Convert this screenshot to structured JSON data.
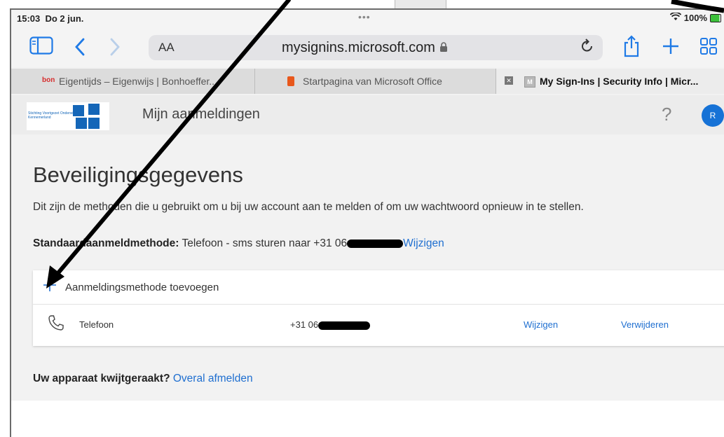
{
  "status": {
    "time": "15:03",
    "date": "Do 2 jun.",
    "multitask_dots": "•••",
    "battery": "100%"
  },
  "toolbar": {
    "text_size": "AA",
    "url": "mysignins.microsoft.com"
  },
  "tabs": [
    {
      "favicon": "bon",
      "label": "Eigentijds – Eigenwijs | Bonhoeffer..."
    },
    {
      "label": "Startpagina van Microsoft Office"
    },
    {
      "favicon": "M",
      "label": "My Sign-Ins | Security Info | Micr..."
    }
  ],
  "header": {
    "title": "Mijn aanmeldingen",
    "help": "?",
    "avatar_initials": "R",
    "logo_text": "Stichting Voortgezet Onderwijs Kennemerland"
  },
  "main": {
    "heading": "Beveiligingsgegevens",
    "description": "Dit zijn de methoden die u gebruikt om u bij uw account aan te melden of om uw wachtwoord opnieuw in te stellen.",
    "default_label": "Standaardaanmeldmethode:",
    "default_value": "Telefoon - sms sturen naar +31 06",
    "default_change": "Wijzigen",
    "add_method": "Aanmeldingsmethode toevoegen",
    "methods": [
      {
        "name": "Telefoon",
        "number": "+31 06",
        "change": "Wijzigen",
        "delete": "Verwijderen"
      }
    ],
    "lost_device_question": "Uw apparaat kwijtgeraakt?",
    "lost_device_link": "Overal afmelden"
  },
  "colors": {
    "accent": "#1f6fd0",
    "avatar": "#1672d6",
    "annotation_arrow": "#000000"
  }
}
